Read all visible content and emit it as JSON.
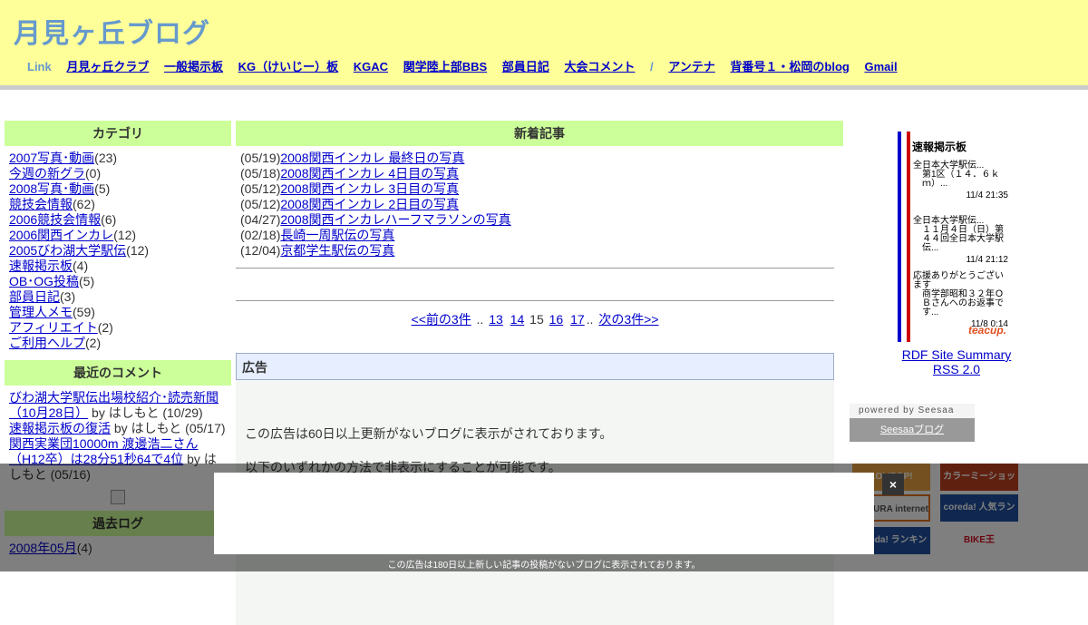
{
  "header": {
    "title": "月見ヶ丘ブログ",
    "link_label": "Link",
    "links": [
      "月見ヶ丘クラブ",
      "一般掲示板",
      "KG（けいじー）板",
      "KGAC",
      "関学陸上部BBS",
      "部員日記",
      "大会コメント"
    ],
    "separator": "/",
    "links2": [
      "アンテナ",
      "背番号１・松岡のblog",
      "Gmail"
    ]
  },
  "categories": {
    "heading": "カテゴリ",
    "items": [
      {
        "name": "2007写真･動画",
        "count": "(23)"
      },
      {
        "name": "今週の新グラ",
        "count": "(0)"
      },
      {
        "name": "2008写真･動画",
        "count": "(5)"
      },
      {
        "name": "競技会情報",
        "count": "(62)"
      },
      {
        "name": "2006競技会情報",
        "count": "(6)"
      },
      {
        "name": "2006関西インカレ",
        "count": "(12)"
      },
      {
        "name": "2005びわ湖大学駅伝",
        "count": "(12)"
      },
      {
        "name": "速報掲示板",
        "count": "(4)"
      },
      {
        "name": "OB･OG投稿",
        "count": "(5)"
      },
      {
        "name": "部員日記",
        "count": "(3)"
      },
      {
        "name": "管理人メモ",
        "count": "(59)"
      },
      {
        "name": "アフィリエイト",
        "count": "(2)"
      },
      {
        "name": "ご利用ヘルプ",
        "count": "(2)"
      }
    ]
  },
  "recent_comments": {
    "heading": "最近のコメント",
    "items": [
      {
        "title": "びわ湖大学駅伝出場校紹介･読売新聞（10月28日）",
        "by": " by はしもと (10/29)"
      },
      {
        "title": "速報掲示板の復活",
        "by": " by はしもと (05/17)"
      },
      {
        "title": "関西実業団10000m 渡邊浩二さん（H12卒）は28分51秒64で4位",
        "by": " by はしもと (05/16)"
      }
    ]
  },
  "archives": {
    "heading": "過去ログ",
    "items": [
      {
        "name": "2008年05月",
        "count": "(4)"
      }
    ]
  },
  "new_articles": {
    "heading": "新着記事",
    "items": [
      {
        "date": "(05/19)",
        "title": "2008関西インカレ 最終日の写真"
      },
      {
        "date": "(05/18)",
        "title": "2008関西インカレ 4日目の写真"
      },
      {
        "date": "(05/12)",
        "title": "2008関西インカレ 3日目の写真"
      },
      {
        "date": "(05/12)",
        "title": "2008関西インカレ 2日目の写真"
      },
      {
        "date": "(04/27)",
        "title": "2008関西インカレハーフマラソンの写真"
      },
      {
        "date": "(02/18)",
        "title": "長崎一周駅伝の写真"
      },
      {
        "date": "(12/04)",
        "title": "京都学生駅伝の写真"
      }
    ]
  },
  "pager": {
    "prev": "<<前の3件",
    "dots": "..",
    "pages": [
      "13",
      "14"
    ],
    "current": "15",
    "pages_after": [
      "16",
      "17"
    ],
    "next": "次の3件>>"
  },
  "ad_box": {
    "heading": "広告",
    "text1": "この広告は60日以上更新がないブログに表示がされております。",
    "text2": "以下のいずれかの方法で非表示にすることが可能です。"
  },
  "bbs": {
    "title": "速報掲示板",
    "entries": [
      {
        "l1": "全日本大学駅伝...",
        "l2": "第1区（１４．６ｋｍ）...",
        "date": "11/4 21:35"
      },
      {
        "l1": "全日本大学駅伝...",
        "l2": "１１月４日（日）第４４回全日本大学駅伝...",
        "date": "11/4 21:12"
      },
      {
        "l1": "応援ありがとうございます",
        "l2": "商学部昭和３２年ＯＢさんへのお返事です...",
        "date": "11/8 0:14"
      }
    ],
    "teacup": "teacup."
  },
  "rss": {
    "rdf": "RDF Site Summary",
    "rss2": "RSS 2.0"
  },
  "seesaa": {
    "powered": "powered by Seesaa",
    "blog": "Seesaaブログ"
  },
  "banners": [
    "LOLIPOP!",
    "カラーミーショップ",
    "SAKURA internet",
    "coreda! 人気ランキング",
    "coreda! ランキング",
    "BIKE王"
  ],
  "overlay": {
    "close": "×",
    "note": "この広告は180日以上新しい記事の投稿がないブログに表示されております。"
  },
  "colors": {
    "header_bg": "#ffff99",
    "title": "#6699cc",
    "box_heading_bg": "#ccff99",
    "link": "#0000cc"
  }
}
